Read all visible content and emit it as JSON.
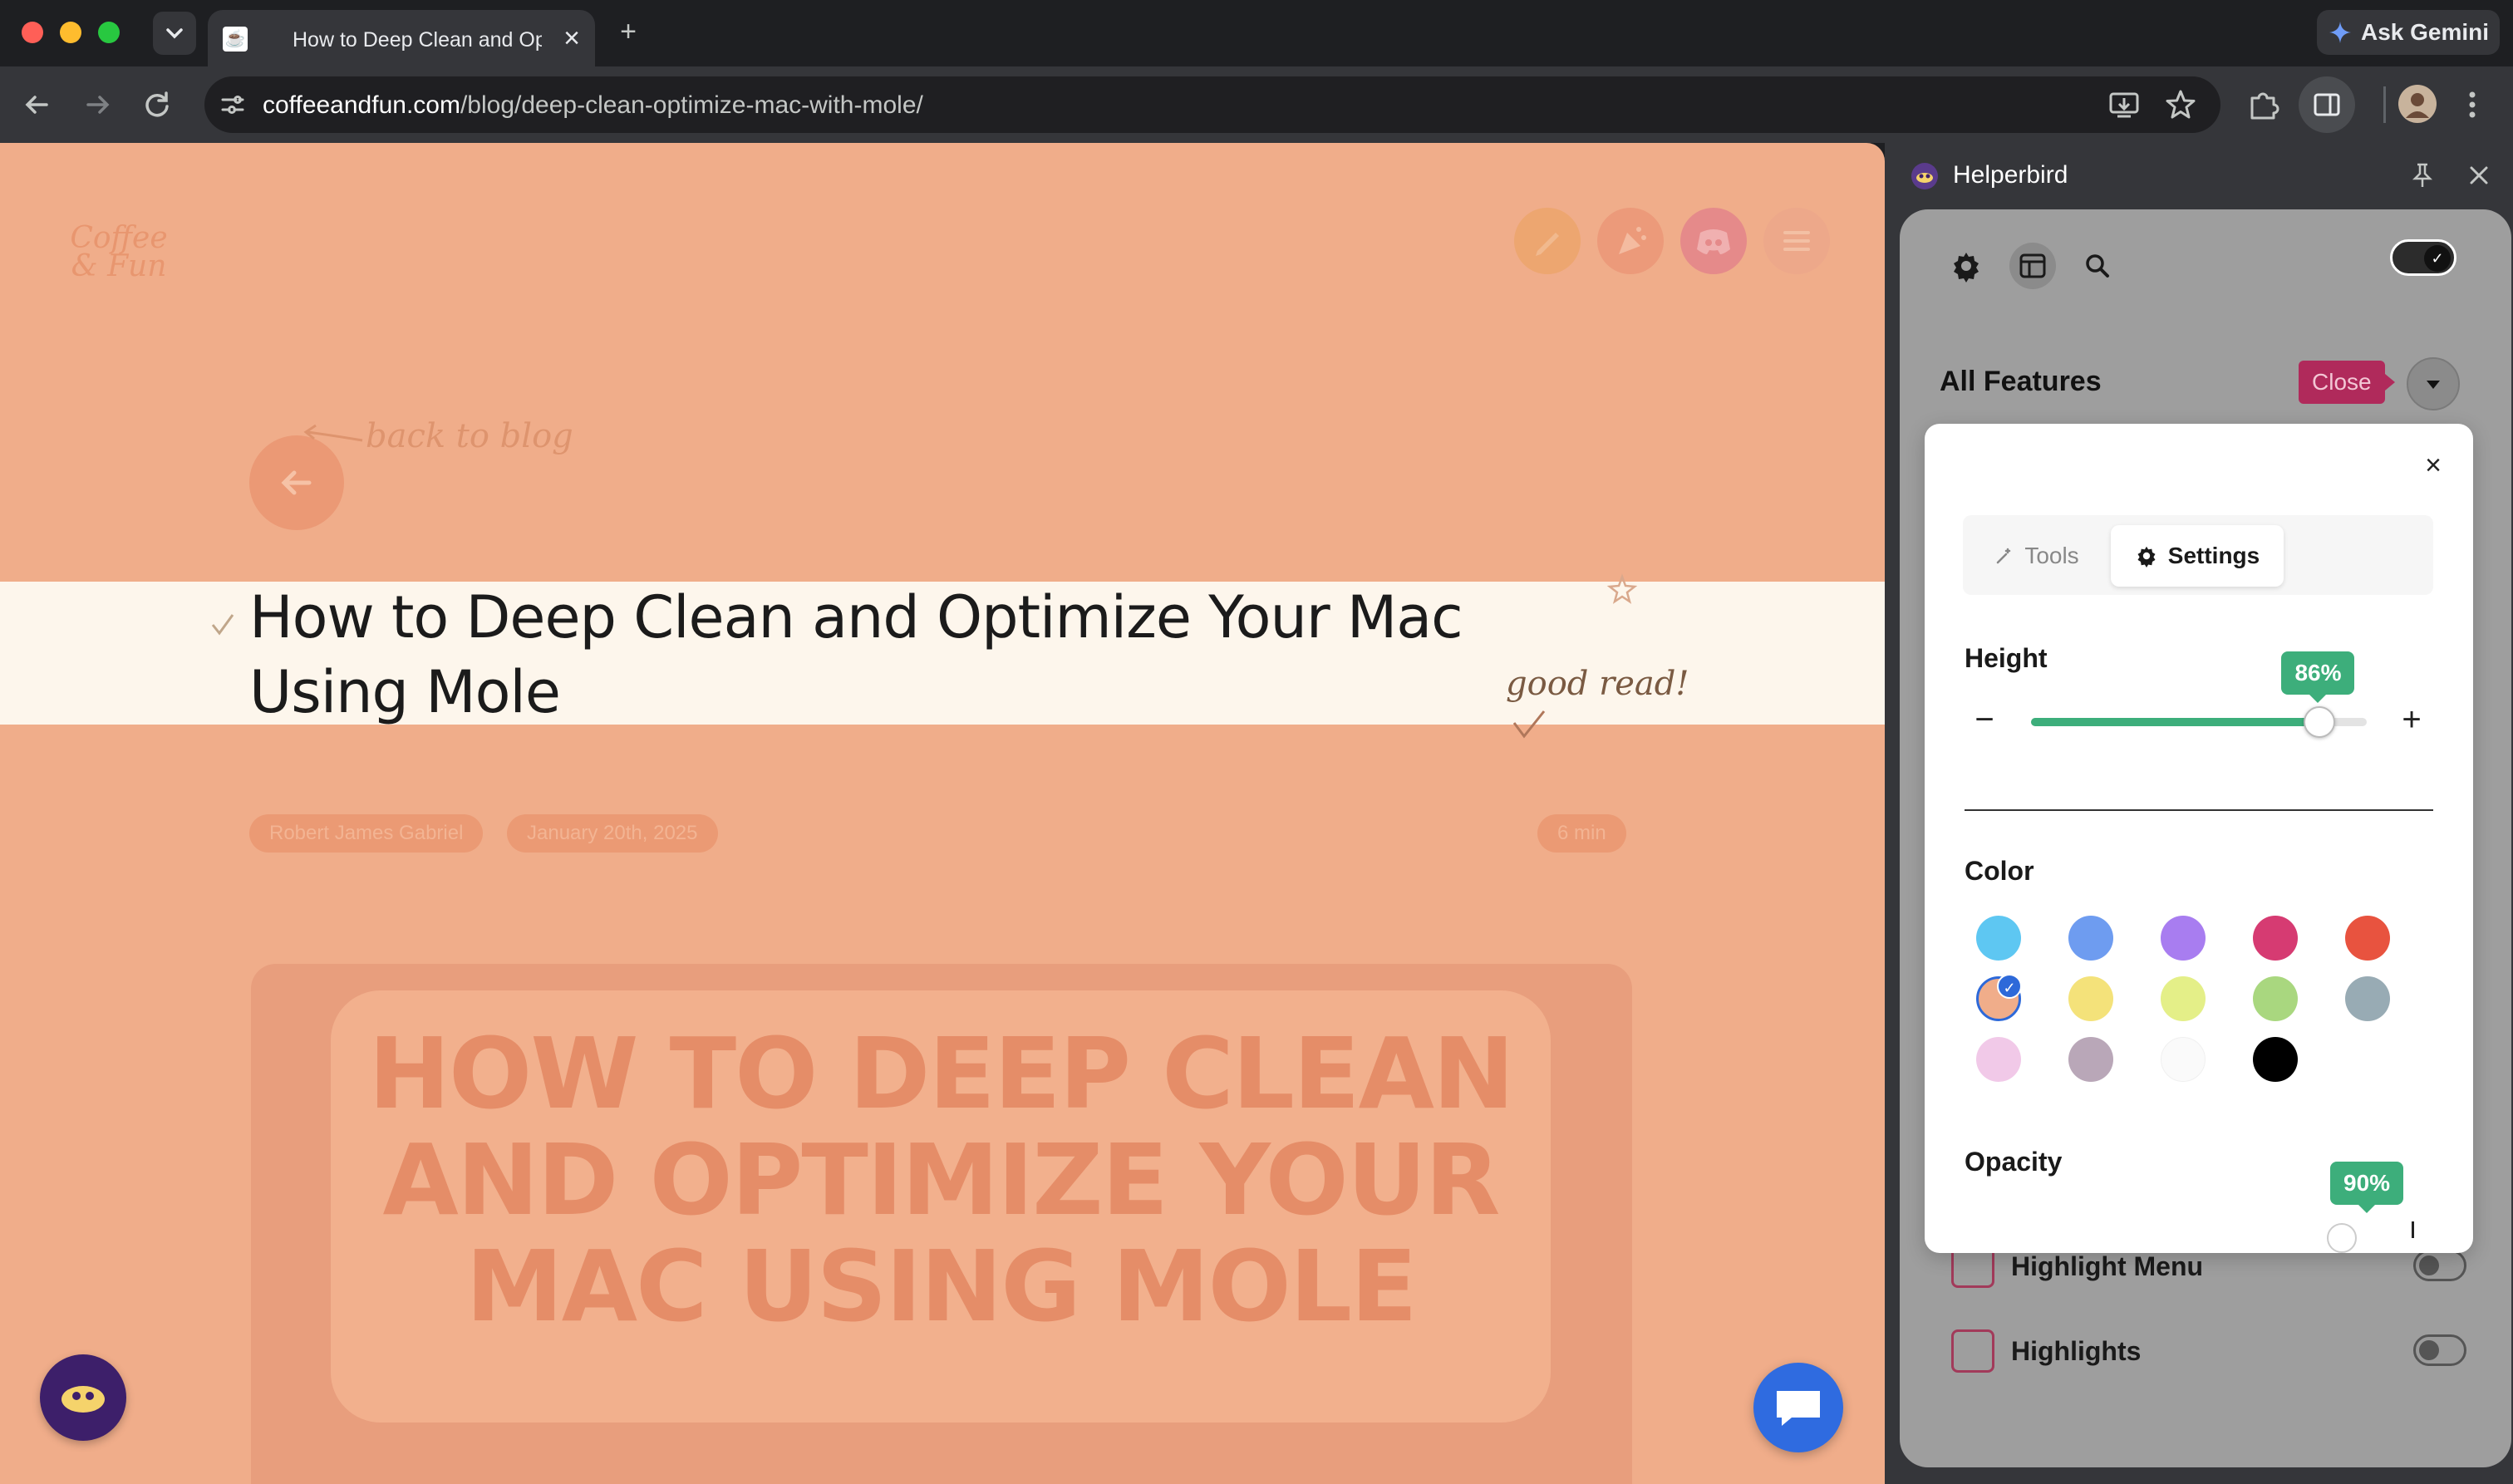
{
  "browser": {
    "tab_title": "How to Deep Clean and Optimize Your Mac Using Mole",
    "tab_close": "×",
    "new_tab": "+",
    "ask_gemini": "Ask Gemini",
    "url_host": "coffeeandfun.com",
    "url_path": "/blog/deep-clean-optimize-mac-with-mole/"
  },
  "page": {
    "logo_text": "Coffee & Fun",
    "back_to_blog": "back to blog",
    "heading": "How to Deep Clean and Optimize Your Mac Using Mole",
    "good_read": "good read!",
    "author": "Robert James Gabriel",
    "date": "January 20th, 2025",
    "read_time": "6 min",
    "hero_title": "HOW TO DEEP CLEAN AND OPTIMIZE YOUR MAC USING MOLE"
  },
  "sidepanel": {
    "title": "Helperbird",
    "all_features": "All Features",
    "close_tooltip": "Close",
    "features": [
      {
        "label": "Highlight Menu",
        "enabled": false
      },
      {
        "label": "Highlights",
        "enabled": false
      }
    ]
  },
  "popup": {
    "close": "×",
    "tabs": {
      "tools": "Tools",
      "settings": "Settings"
    },
    "height": {
      "label": "Height",
      "value": 86,
      "display": "86%",
      "minus": "−",
      "plus": "+"
    },
    "color": {
      "label": "Color",
      "swatches": [
        "#5ec7f2",
        "#6e9cf0",
        "#a87df0",
        "#d63b72",
        "#e8533f",
        "#f0ad8a",
        "#f4e27a",
        "#e4ef88",
        "#a9d77f",
        "#98abb4",
        "#f1c9e8",
        "#b9a7b8",
        "#fafafa",
        "#000000"
      ],
      "selected_index": 5
    },
    "opacity": {
      "label": "Opacity",
      "value": 90,
      "display": "90%"
    }
  },
  "colors": {
    "accent_green": "#3dae7b",
    "page_overlay": "#f0ad8a",
    "tooltip": "#b02a5b"
  }
}
